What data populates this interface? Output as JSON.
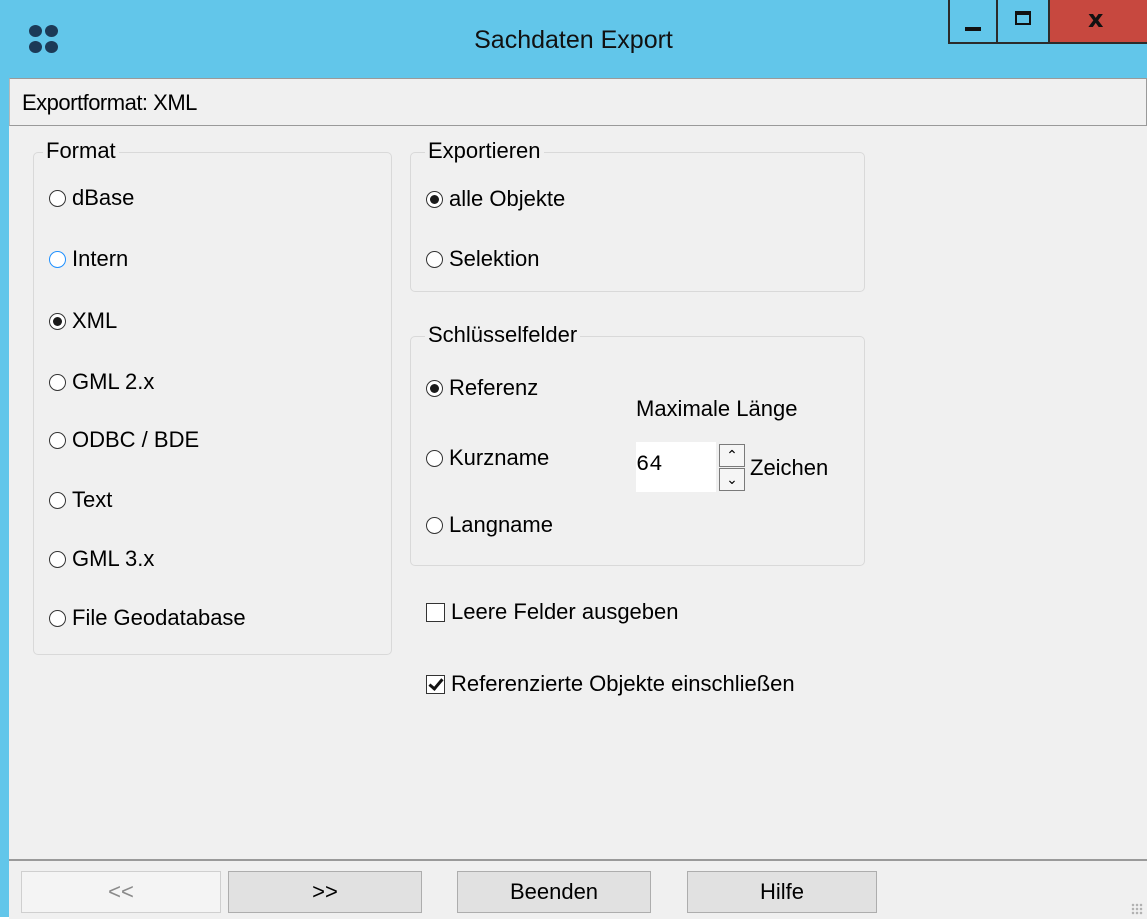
{
  "window": {
    "title": "Sachdaten Export",
    "controls": {
      "minimize": "minimize",
      "maximize": "maximize",
      "close": "close"
    }
  },
  "status": {
    "text": "Exportformat: XML"
  },
  "format_group": {
    "legend": "Format",
    "options": [
      "dBase",
      "Intern",
      "XML",
      "GML 2.x",
      "ODBC / BDE",
      "Text",
      "GML 3.x",
      "File Geodatabase"
    ],
    "selected": "XML",
    "focused": "Intern"
  },
  "export_group": {
    "legend": "Exportieren",
    "options": [
      "alle Objekte",
      "Selektion"
    ],
    "selected": "alle Objekte"
  },
  "key_group": {
    "legend": "Schlüsselfelder",
    "options": [
      "Referenz",
      "Kurzname",
      "Langname"
    ],
    "selected": "Referenz",
    "max_length_label": "Maximale Länge",
    "max_length_value": "64",
    "unit_label": "Zeichen"
  },
  "checkboxes": {
    "empty_fields": {
      "label": "Leere Felder ausgeben",
      "checked": false
    },
    "referenced_objects": {
      "label": "Referenzierte Objekte einschließen",
      "checked": true
    }
  },
  "buttons": {
    "back": "<<",
    "next": ">>",
    "exit": "Beenden",
    "help": "Hilfe"
  }
}
